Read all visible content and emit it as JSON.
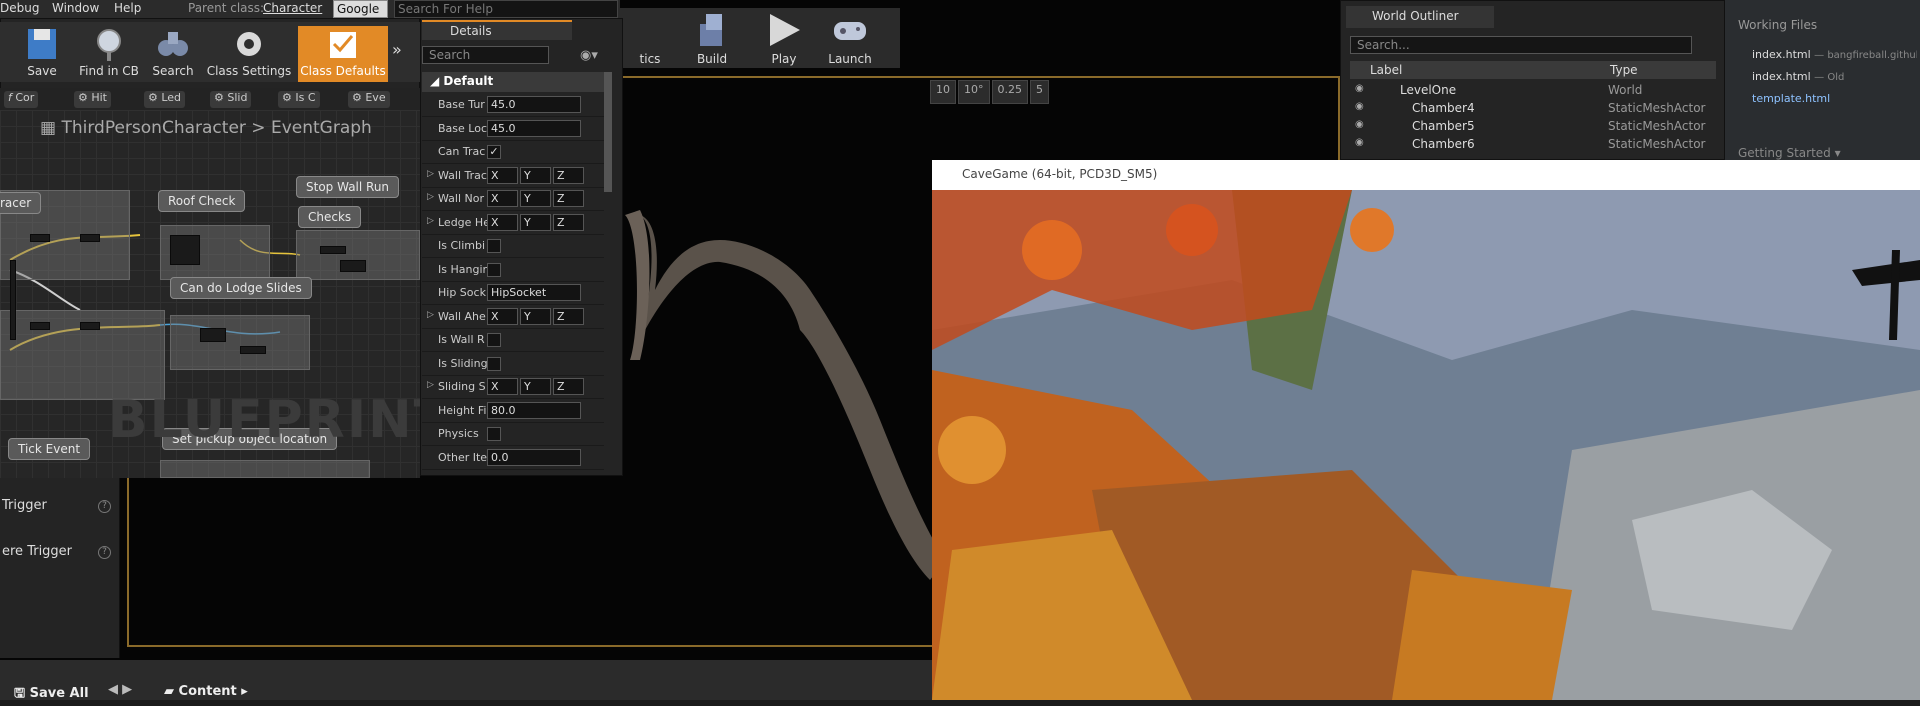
{
  "menubar": {
    "items": [
      "Debug",
      "Window",
      "Help"
    ],
    "parent_class_label": "Parent class:",
    "parent_class_value": "Character",
    "google": "Google",
    "search_placeholder": "Search For Help"
  },
  "toolbar": {
    "buttons": [
      "Save",
      "Find in CB",
      "Search",
      "Class Settings",
      "Class Defaults"
    ]
  },
  "functions": [
    "Cor",
    "Hit",
    "Led",
    "Slid",
    "Is C",
    "Eve"
  ],
  "breadcrumb": {
    "blueprint": "ThirdPersonCharacter",
    "graph": "EventGraph"
  },
  "graph": {
    "comments": [
      "racer",
      "Roof Check",
      "Stop Wall Run",
      "Checks",
      "Can do Lodge Slides",
      "Set pickup object location",
      "Tick Event"
    ],
    "watermark": "BLUEPRINT"
  },
  "details": {
    "tab": "Details",
    "search_placeholder": "Search",
    "section": "Default",
    "rows": [
      {
        "name": "Base Tur",
        "value": "45.0"
      },
      {
        "name": "Base Loc",
        "value": "45.0"
      },
      {
        "name": "Can Trac",
        "value": ""
      },
      {
        "name": "Wall Trac",
        "value": ""
      },
      {
        "name": "Wall Nor",
        "value": ""
      },
      {
        "name": "Ledge He",
        "value": ""
      },
      {
        "name": "Is Climbi",
        "value": ""
      },
      {
        "name": "Is Hangir",
        "value": ""
      },
      {
        "name": "Hip Sock",
        "value": "HipSocket"
      },
      {
        "name": "Wall Ahe",
        "value": ""
      },
      {
        "name": "Is Wall R",
        "value": ""
      },
      {
        "name": "Is Sliding",
        "value": ""
      },
      {
        "name": "Sliding S",
        "value": ""
      },
      {
        "name": "Height Fi",
        "value": "80.0"
      },
      {
        "name": "Physics",
        "value": ""
      },
      {
        "name": "Other Ite",
        "value": "0.0"
      }
    ],
    "xyz": [
      "X",
      "Y",
      "Z"
    ]
  },
  "triggers": [
    "Trigger",
    "ere Trigger"
  ],
  "main_toolbar": {
    "buttons": [
      "tics",
      "Build",
      "Play",
      "Launch"
    ]
  },
  "viewport_tools": [
    "10",
    "10°",
    "0.25",
    "5"
  ],
  "status": {
    "save_all": "Save All",
    "content": "Content"
  },
  "outliner": {
    "tab": "World Outliner",
    "search_placeholder": "Search...",
    "col_label": "Label",
    "col_type": "Type",
    "rows": [
      {
        "label": "LevelOne",
        "type": "World"
      },
      {
        "label": "Chamber4",
        "type": "StaticMeshActor"
      },
      {
        "label": "Chamber5",
        "type": "StaticMeshActor"
      },
      {
        "label": "Chamber6",
        "type": "StaticMeshActor"
      }
    ]
  },
  "brackets": {
    "title": "Working Files",
    "files": [
      {
        "name": "index.html",
        "note": "— bangfireball.github."
      },
      {
        "name": "index.html",
        "note": "— Old"
      },
      {
        "name": "template.html",
        "note": ""
      }
    ],
    "getting_started": "Getting Started"
  },
  "game": {
    "title": "CaveGame (64-bit, PCD3D_SM5)"
  },
  "colors": {
    "accent": "#e28a26",
    "panel": "#242424"
  }
}
